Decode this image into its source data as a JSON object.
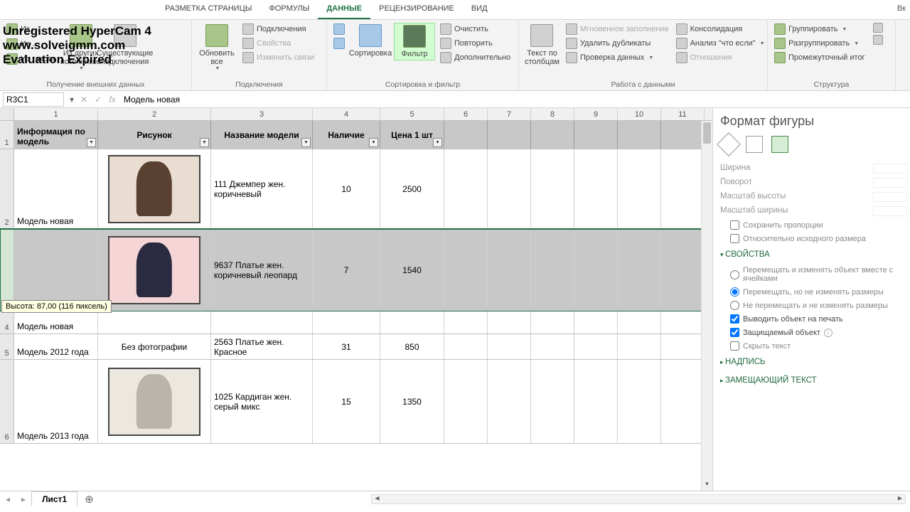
{
  "watermark": {
    "line1": "Unregistered HyperCam 4",
    "line2": "www.solveigmm.com",
    "line3": "Evaluation Expired"
  },
  "tabs": {
    "page_layout": "РАЗМЕТКА СТРАНИЦЫ",
    "formulas": "ФОРМУЛЫ",
    "data": "ДАННЫЕ",
    "review": "РЕЦЕНЗИРОВАНИЕ",
    "view": "ВИД"
  },
  "ribbon": {
    "g1": {
      "from_text": "Из текста",
      "from_other": "Из других источников",
      "existing": "Существующие подключения",
      "label": "Получение внешних данных"
    },
    "g2": {
      "refresh": "Обновить все",
      "connections": "Подключения",
      "properties": "Свойства",
      "edit_links": "Изменить связи",
      "label": "Подключения"
    },
    "g3": {
      "sort": "Сортировка",
      "filter": "Фильтр",
      "clear": "Очистить",
      "reapply": "Повторить",
      "advanced": "Дополнительно",
      "label": "Сортировка и фильтр"
    },
    "g4": {
      "text_to_cols": "Текст по столбцам",
      "flash_fill": "Мгновенное заполнение",
      "remove_dup": "Удалить дубликаты",
      "validation": "Проверка данных",
      "consolidate": "Консолидация",
      "what_if": "Анализ \"что если\"",
      "relations": "Отношения",
      "label": "Работа с данными"
    },
    "g5": {
      "group": "Группировать",
      "ungroup": "Разгруппировать",
      "subtotal": "Промежуточный итог",
      "label": "Структура"
    }
  },
  "formula_bar": {
    "name_box": "R3C1",
    "formula": "Модель новая"
  },
  "col_numbers": [
    "1",
    "2",
    "3",
    "4",
    "5",
    "6",
    "7",
    "8",
    "9",
    "10",
    "11"
  ],
  "table": {
    "headers": {
      "info": "Информация по модель",
      "picture": "Рисунок",
      "name": "Название модели",
      "stock": "Наличие",
      "price": "Цена 1 шт"
    },
    "rows": [
      {
        "info": "Модель новая",
        "name": "111 Джемпер жен. коричневый",
        "stock": "10",
        "price": "2500",
        "img": true
      },
      {
        "info": "Модель новая",
        "name": "9637 Платье жен. коричневый леопард",
        "stock": "7",
        "price": "1540",
        "img": true,
        "selected": true
      },
      {
        "info": "Модель 2012 года",
        "pic_text": "Без фотографии",
        "name": "2563 Платье жен. Красное",
        "stock": "31",
        "price": "850",
        "img": false
      },
      {
        "info": "Модель 2013 года",
        "name": "1025 Кардиган жен. серый микс",
        "stock": "15",
        "price": "1350",
        "img": true
      }
    ]
  },
  "resize_tooltip": "Высота: 87,00 (116 пиксель)",
  "side": {
    "title": "Формат фигуры",
    "width": "Ширина",
    "rotation": "Поворот",
    "scale_h": "Масштаб высоты",
    "scale_w": "Масштаб ширины",
    "lock_aspect": "Сохранить пропорции",
    "relative": "Относительно исходного размера",
    "sec_props": "СВОЙСТВА",
    "opt1": "Перемещать и изменять объект вместе с ячейками",
    "opt2": "Перемещать, но не изменять размеры",
    "opt3": "Не перемещать и не изменять размеры",
    "print_obj": "Выводить объект на печать",
    "protected": "Защищаемый объект",
    "hide_text": "Скрыть текст",
    "sec_caption": "НАДПИСЬ",
    "sec_alt": "ЗАМЕЩАЮЩИЙ ТЕКСТ"
  },
  "sheet": {
    "name": "Лист1"
  }
}
